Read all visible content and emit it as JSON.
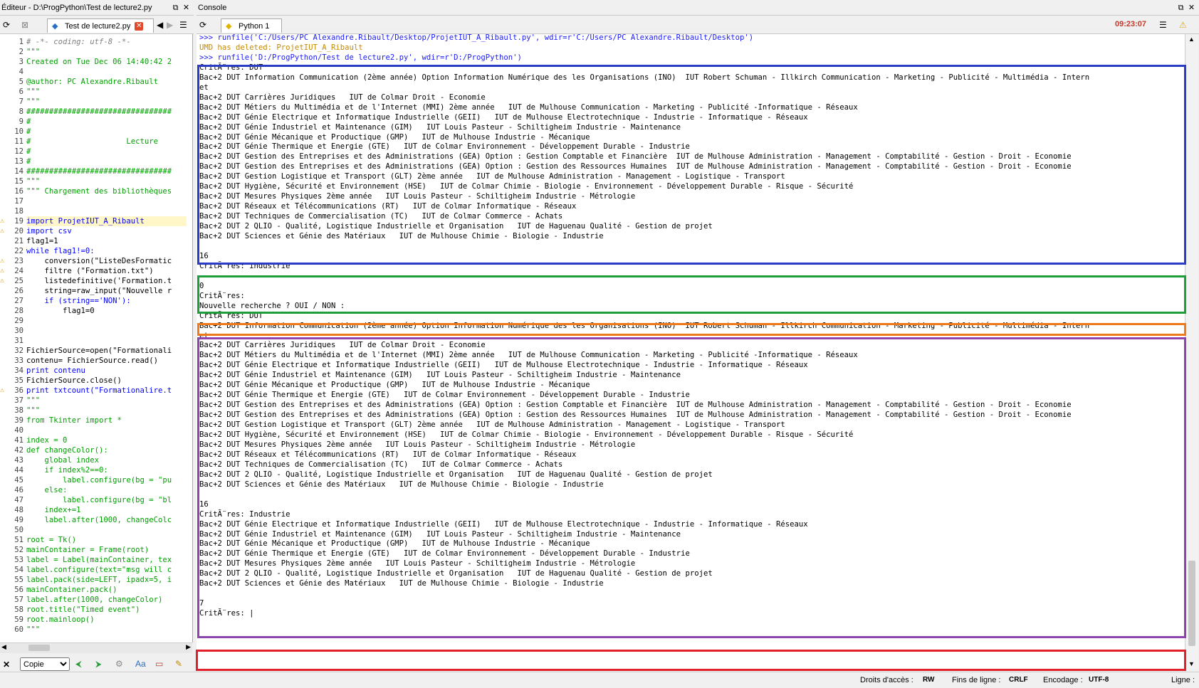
{
  "editor": {
    "title": "Éditeur - D:\\ProgPython\\Test de lecture2.py",
    "tab_label": "Test de lecture2.py",
    "lines": [
      {
        "n": "1",
        "t": "# -*- coding: utf-8 -*-",
        "c": "com"
      },
      {
        "n": "2",
        "t": "\"\"\"",
        "c": "str"
      },
      {
        "n": "3",
        "t": "Created on Tue Dec 06 14:40:42 2",
        "c": "str"
      },
      {
        "n": "4",
        "t": "",
        "c": ""
      },
      {
        "n": "5",
        "t": "@author: PC Alexandre.Ribault",
        "c": "str"
      },
      {
        "n": "6",
        "t": "\"\"\"",
        "c": "str"
      },
      {
        "n": "7",
        "t": "\"\"\"",
        "c": "str"
      },
      {
        "n": "8",
        "t": "################################",
        "c": "str"
      },
      {
        "n": "9",
        "t": "#",
        "c": "str"
      },
      {
        "n": "10",
        "t": "#",
        "c": "str"
      },
      {
        "n": "11",
        "t": "#                     Lecture",
        "c": "str"
      },
      {
        "n": "12",
        "t": "#",
        "c": "str"
      },
      {
        "n": "13",
        "t": "#",
        "c": "str"
      },
      {
        "n": "14",
        "t": "################################",
        "c": "str"
      },
      {
        "n": "15",
        "t": "\"\"\"",
        "c": "str"
      },
      {
        "n": "16",
        "t": "\"\"\" Chargement des bibliothèques",
        "c": "str"
      },
      {
        "n": "17",
        "t": "",
        "c": ""
      },
      {
        "n": "18",
        "t": "",
        "c": ""
      },
      {
        "n": "19",
        "t": "import ProjetIUT_A_Ribault",
        "c": "imp",
        "w": true,
        "hl": true
      },
      {
        "n": "20",
        "t": "import csv",
        "c": "imp",
        "w": true
      },
      {
        "n": "21",
        "t": "flag1=1",
        "c": ""
      },
      {
        "n": "22",
        "t": "while flag1!=0:",
        "c": "kw"
      },
      {
        "n": "23",
        "t": "    conversion(\"ListeDesFormatic",
        "c": "",
        "w": true
      },
      {
        "n": "24",
        "t": "    filtre (\"Formation.txt\")",
        "c": "",
        "w": true
      },
      {
        "n": "25",
        "t": "    listedefinitive('Formation.t",
        "c": "",
        "w": true
      },
      {
        "n": "26",
        "t": "    string=raw_input(\"Nouvelle r",
        "c": ""
      },
      {
        "n": "27",
        "t": "    if (string=='NON'):",
        "c": "kw"
      },
      {
        "n": "28",
        "t": "        flag1=0",
        "c": ""
      },
      {
        "n": "29",
        "t": "",
        "c": ""
      },
      {
        "n": "30",
        "t": "",
        "c": ""
      },
      {
        "n": "31",
        "t": "",
        "c": ""
      },
      {
        "n": "32",
        "t": "FichierSource=open(\"Formationali",
        "c": ""
      },
      {
        "n": "33",
        "t": "contenu= FichierSource.read()",
        "c": ""
      },
      {
        "n": "34",
        "t": "print contenu",
        "c": "kw"
      },
      {
        "n": "35",
        "t": "FichierSource.close()",
        "c": ""
      },
      {
        "n": "36",
        "t": "print txtcount(\"Formationalire.t",
        "c": "kw",
        "w": true
      },
      {
        "n": "37",
        "t": "\"\"\"",
        "c": "str"
      },
      {
        "n": "38",
        "t": "\"\"\"",
        "c": "str"
      },
      {
        "n": "39",
        "t": "from Tkinter import *",
        "c": "str"
      },
      {
        "n": "40",
        "t": "",
        "c": "str"
      },
      {
        "n": "41",
        "t": "index = 0",
        "c": "str"
      },
      {
        "n": "42",
        "t": "def changeColor():",
        "c": "str"
      },
      {
        "n": "43",
        "t": "    global index",
        "c": "str"
      },
      {
        "n": "44",
        "t": "    if index%2==0:",
        "c": "str"
      },
      {
        "n": "45",
        "t": "        label.configure(bg = \"pu",
        "c": "str"
      },
      {
        "n": "46",
        "t": "    else:",
        "c": "str"
      },
      {
        "n": "47",
        "t": "        label.configure(bg = \"bl",
        "c": "str"
      },
      {
        "n": "48",
        "t": "    index+=1",
        "c": "str"
      },
      {
        "n": "49",
        "t": "    label.after(1000, changeColc",
        "c": "str"
      },
      {
        "n": "50",
        "t": "",
        "c": "str"
      },
      {
        "n": "51",
        "t": "root = Tk()",
        "c": "str"
      },
      {
        "n": "52",
        "t": "mainContainer = Frame(root)",
        "c": "str"
      },
      {
        "n": "53",
        "t": "label = Label(mainContainer, tex",
        "c": "str"
      },
      {
        "n": "54",
        "t": "label.configure(text=\"msg will c",
        "c": "str"
      },
      {
        "n": "55",
        "t": "label.pack(side=LEFT, ipadx=5, i",
        "c": "str"
      },
      {
        "n": "56",
        "t": "mainContainer.pack()",
        "c": "str"
      },
      {
        "n": "57",
        "t": "label.after(1000, changeColor)",
        "c": "str"
      },
      {
        "n": "58",
        "t": "root.title(\"Timed event\")",
        "c": "str"
      },
      {
        "n": "59",
        "t": "root.mainloop()",
        "c": "str"
      },
      {
        "n": "60",
        "t": "\"\"\"",
        "c": "str"
      }
    ],
    "bottom_select": "Copie"
  },
  "console": {
    "title": "Console",
    "tab_label": "Python 1",
    "time": "09:23:07",
    "lines": [
      {
        "t": ">>> runfile('C:/Users/PC Alexandre.Ribault/Desktop/ProjetIUT_A_Ribault.py', wdir=r'C:/Users/PC Alexandre.Ribault/Desktop')",
        "c": "prompt"
      },
      {
        "t": "UMD has deleted: ProjetIUT_A_Ribault",
        "c": "orange"
      },
      {
        "t": ">>> runfile('D:/ProgPython/Test de lecture2.py', wdir=r'D:/ProgPython')",
        "c": "prompt"
      },
      {
        "t": "CritÃ¨res: DUT",
        "c": ""
      },
      {
        "t": "Bac+2 DUT Information Communication (2ème année) Option Information Numérique des les Organisations (INO)  IUT Robert Schuman - Illkirch Communication - Marketing - Publicité - Multimédia - Intern",
        "c": ""
      },
      {
        "t": "et",
        "c": ""
      },
      {
        "t": "Bac+2 DUT Carrières Juridiques   IUT de Colmar Droit - Economie",
        "c": ""
      },
      {
        "t": "Bac+2 DUT Métiers du Multimédia et de l'Internet (MMI) 2ème année   IUT de Mulhouse Communication - Marketing - Publicité -Informatique - Réseaux",
        "c": ""
      },
      {
        "t": "Bac+2 DUT Génie Electrique et Informatique Industrielle (GEII)   IUT de Mulhouse Electrotechnique - Industrie - Informatique - Réseaux",
        "c": ""
      },
      {
        "t": "Bac+2 DUT Génie Industriel et Maintenance (GIM)   IUT Louis Pasteur - Schiltigheim Industrie - Maintenance",
        "c": ""
      },
      {
        "t": "Bac+2 DUT Génie Mécanique et Productique (GMP)   IUT de Mulhouse Industrie - Mécanique",
        "c": ""
      },
      {
        "t": "Bac+2 DUT Génie Thermique et Energie (GTE)   IUT de Colmar Environnement - Développement Durable - Industrie",
        "c": ""
      },
      {
        "t": "Bac+2 DUT Gestion des Entreprises et des Administrations (GEA) Option : Gestion Comptable et Financière  IUT de Mulhouse Administration - Management - Comptabilité - Gestion - Droit - Economie",
        "c": ""
      },
      {
        "t": "Bac+2 DUT Gestion des Entreprises et des Administrations (GEA) Option : Gestion des Ressources Humaines  IUT de Mulhouse Administration - Management - Comptabilité - Gestion - Droit - Economie",
        "c": ""
      },
      {
        "t": "Bac+2 DUT Gestion Logistique et Transport (GLT) 2ème année   IUT de Mulhouse Administration - Management - Logistique - Transport",
        "c": ""
      },
      {
        "t": "Bac+2 DUT Hygiène, Sécurité et Environnement (HSE)   IUT de Colmar Chimie - Biologie - Environnement - Développement Durable - Risque - Sécurité",
        "c": ""
      },
      {
        "t": "Bac+2 DUT Mesures Physiques 2ème année   IUT Louis Pasteur - Schiltigheim Industrie - Métrologie",
        "c": ""
      },
      {
        "t": "Bac+2 DUT Réseaux et Télécommunications (RT)   IUT de Colmar Informatique - Réseaux",
        "c": ""
      },
      {
        "t": "Bac+2 DUT Techniques de Commercialisation (TC)   IUT de Colmar Commerce - Achats",
        "c": ""
      },
      {
        "t": "Bac+2 DUT 2 QLIO - Qualité, Logistique Industrielle et Organisation   IUT de Haguenau Qualité - Gestion de projet",
        "c": ""
      },
      {
        "t": "Bac+2 DUT Sciences et Génie des Matériaux   IUT de Mulhouse Chimie - Biologie - Industrie",
        "c": ""
      },
      {
        "t": "",
        "c": ""
      },
      {
        "t": "16",
        "c": ""
      },
      {
        "t": "CritÃ¨res: industrie",
        "c": ""
      },
      {
        "t": "",
        "c": ""
      },
      {
        "t": "0",
        "c": ""
      },
      {
        "t": "CritÃ¨res:",
        "c": ""
      },
      {
        "t": "Nouvelle recherche ? OUI / NON :",
        "c": ""
      },
      {
        "t": "CritÃ¨res: DUT",
        "c": ""
      },
      {
        "t": "Bac+2 DUT Information Communication (2ème année) Option Information Numérique des les Organisations (INO)  IUT Robert Schuman - Illkirch Communication - Marketing - Publicité - Multimédia - Intern",
        "c": ""
      },
      {
        "t": "et",
        "c": ""
      },
      {
        "t": "Bac+2 DUT Carrières Juridiques   IUT de Colmar Droit - Economie",
        "c": ""
      },
      {
        "t": "Bac+2 DUT Métiers du Multimédia et de l'Internet (MMI) 2ème année   IUT de Mulhouse Communication - Marketing - Publicité -Informatique - Réseaux",
        "c": ""
      },
      {
        "t": "Bac+2 DUT Génie Electrique et Informatique Industrielle (GEII)   IUT de Mulhouse Electrotechnique - Industrie - Informatique - Réseaux",
        "c": ""
      },
      {
        "t": "Bac+2 DUT Génie Industriel et Maintenance (GIM)   IUT Louis Pasteur - Schiltigheim Industrie - Maintenance",
        "c": ""
      },
      {
        "t": "Bac+2 DUT Génie Mécanique et Productique (GMP)   IUT de Mulhouse Industrie - Mécanique",
        "c": ""
      },
      {
        "t": "Bac+2 DUT Génie Thermique et Energie (GTE)   IUT de Colmar Environnement - Développement Durable - Industrie",
        "c": ""
      },
      {
        "t": "Bac+2 DUT Gestion des Entreprises et des Administrations (GEA) Option : Gestion Comptable et Financière  IUT de Mulhouse Administration - Management - Comptabilité - Gestion - Droit - Economie",
        "c": ""
      },
      {
        "t": "Bac+2 DUT Gestion des Entreprises et des Administrations (GEA) Option : Gestion des Ressources Humaines  IUT de Mulhouse Administration - Management - Comptabilité - Gestion - Droit - Economie",
        "c": ""
      },
      {
        "t": "Bac+2 DUT Gestion Logistique et Transport (GLT) 2ème année   IUT de Mulhouse Administration - Management - Logistique - Transport",
        "c": ""
      },
      {
        "t": "Bac+2 DUT Hygiène, Sécurité et Environnement (HSE)   IUT de Colmar Chimie - Biologie - Environnement - Développement Durable - Risque - Sécurité",
        "c": ""
      },
      {
        "t": "Bac+2 DUT Mesures Physiques 2ème année   IUT Louis Pasteur - Schiltigheim Industrie - Métrologie",
        "c": ""
      },
      {
        "t": "Bac+2 DUT Réseaux et Télécommunications (RT)   IUT de Colmar Informatique - Réseaux",
        "c": ""
      },
      {
        "t": "Bac+2 DUT Techniques de Commercialisation (TC)   IUT de Colmar Commerce - Achats",
        "c": ""
      },
      {
        "t": "Bac+2 DUT 2 QLIO - Qualité, Logistique Industrielle et Organisation   IUT de Haguenau Qualité - Gestion de projet",
        "c": ""
      },
      {
        "t": "Bac+2 DUT Sciences et Génie des Matériaux   IUT de Mulhouse Chimie - Biologie - Industrie",
        "c": ""
      },
      {
        "t": "",
        "c": ""
      },
      {
        "t": "16",
        "c": ""
      },
      {
        "t": "CritÃ¨res: Industrie",
        "c": ""
      },
      {
        "t": "Bac+2 DUT Génie Electrique et Informatique Industrielle (GEII)   IUT de Mulhouse Electrotechnique - Industrie - Informatique - Réseaux",
        "c": ""
      },
      {
        "t": "Bac+2 DUT Génie Industriel et Maintenance (GIM)   IUT Louis Pasteur - Schiltigheim Industrie - Maintenance",
        "c": ""
      },
      {
        "t": "Bac+2 DUT Génie Mécanique et Productique (GMP)   IUT de Mulhouse Industrie - Mécanique",
        "c": ""
      },
      {
        "t": "Bac+2 DUT Génie Thermique et Energie (GTE)   IUT de Colmar Environnement - Développement Durable - Industrie",
        "c": ""
      },
      {
        "t": "Bac+2 DUT Mesures Physiques 2ème année   IUT Louis Pasteur - Schiltigheim Industrie - Métrologie",
        "c": ""
      },
      {
        "t": "Bac+2 DUT 2 QLIO - Qualité, Logistique Industrielle et Organisation   IUT de Haguenau Qualité - Gestion de projet",
        "c": ""
      },
      {
        "t": "Bac+2 DUT Sciences et Génie des Matériaux   IUT de Mulhouse Chimie - Biologie - Industrie",
        "c": ""
      },
      {
        "t": "",
        "c": ""
      },
      {
        "t": "7",
        "c": ""
      },
      {
        "t": "CritÃ¨res: |",
        "c": ""
      }
    ]
  },
  "statusbar": {
    "access_label": "Droits d'accès :",
    "access_value": "RW",
    "eol_label": "Fins de ligne :",
    "eol_value": "CRLF",
    "enc_label": "Encodage :",
    "enc_value": "UTF-8",
    "line_label": "Ligne :"
  },
  "colors": {
    "box_blue": "#2b3cc4",
    "box_green": "#1e9e3a",
    "box_orange": "#f07a1a",
    "box_purple": "#8e44ad",
    "box_red": "#e0202a"
  }
}
